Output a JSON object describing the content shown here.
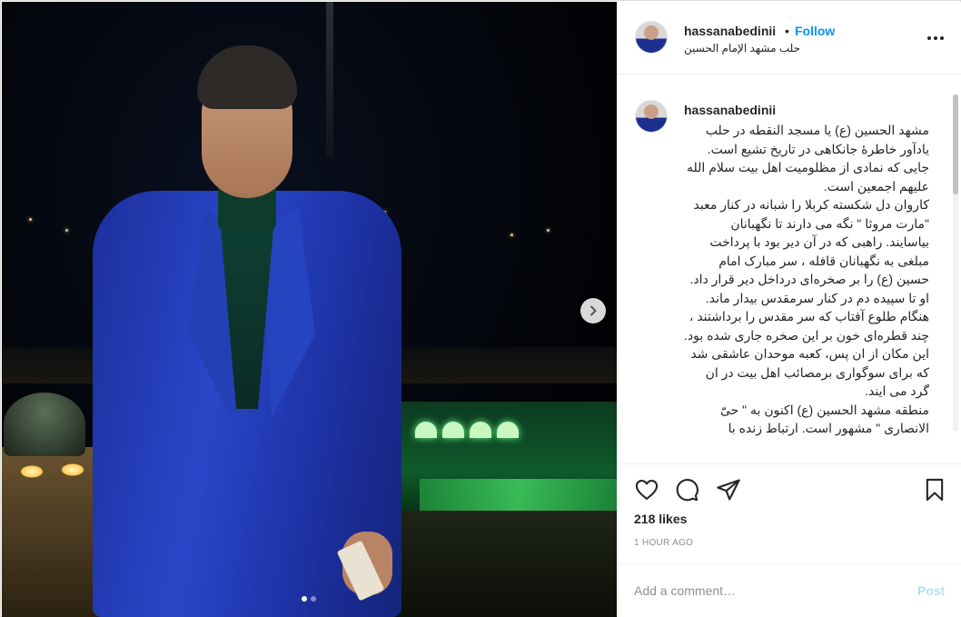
{
  "post": {
    "username": "hassanabedinii",
    "separator": "•",
    "follow_label": "Follow",
    "location": "حلب مشهد الإمام الحسين",
    "caption_username": "hassanabedinii",
    "caption": "مشهد الحسین (ع) یا مسجد النقطه در حلب یادآور خاطرهٔ جانکاهی در تاریخ تشیع است. جایی که نمادی از مظلومیت اهل بیت سلام الله علیهم اجمعین است.\nکاروان دل شکسته کربلا را شبانه در کنار معبد \"مارت مروثا \" نگه می دارند تا نگهبانان بیاسایند. راهبی که در آن دیر بود با پرداخت مبلغی به نگهبانان قافله ، سر مبارک امام حسین (ع) را بر صخره‌ای درداخل دیر قرار داد. او تا سپیده دم در کنار سرمقدس بیدار ماند. هنگام طلوع آفتاب که سر مقدس را برداشتند ، چند قطره‌ای خون بر این صخره جاری شده بود.\nاین مکان از ان پس، کعبه موحدان عاشقی شد که برای سوگواری برمصائب اهل بیت در ان گرد می ایند.\nمنطقه مشهد الحسین (ع) اکنون به \" حیّ الانصاری \" مشهور است. ارتباط زنده با",
    "likes": "218 likes",
    "time": "1 HOUR AGO"
  },
  "comment": {
    "placeholder": "Add a comment…",
    "post_label": "Post"
  },
  "carousel": {
    "slide_count": 2,
    "active_index": 0
  },
  "icons": {
    "more": "more-options-icon",
    "next": "chevron-right-icon",
    "like": "heart-icon",
    "comment": "comment-bubble-icon",
    "share": "paper-plane-icon",
    "save": "bookmark-icon"
  },
  "colors": {
    "accent": "#0095f6",
    "post_disabled": "#b2dffc",
    "muted": "#8e8e8e",
    "text": "#262626"
  }
}
